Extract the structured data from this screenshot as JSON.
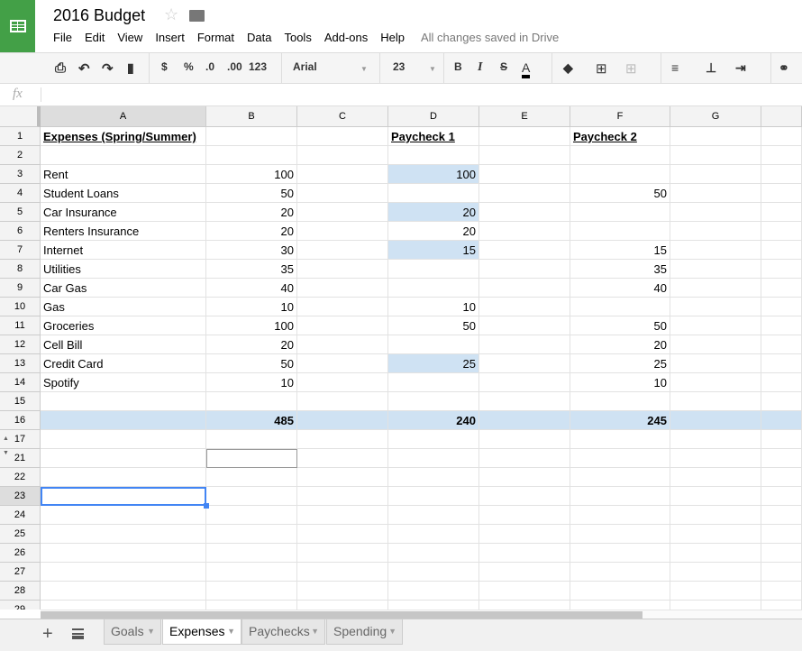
{
  "app": {
    "title": "2016 Budget",
    "status": "All changes saved in Drive",
    "accent": "#43a047"
  },
  "menu": [
    "File",
    "Edit",
    "View",
    "Insert",
    "Format",
    "Data",
    "Tools",
    "Add-ons",
    "Help"
  ],
  "toolbar": {
    "dollar": "$",
    "percent": "%",
    "dec_less": ".0",
    "dec_more": ".00",
    "format": "123",
    "font": "Arial",
    "size": "23",
    "bold": "B",
    "italic": "I",
    "strike": "S",
    "textcolor": "A"
  },
  "formula_bar": {
    "label": "fx",
    "value": ""
  },
  "columns": [
    "A",
    "B",
    "C",
    "D",
    "E",
    "F",
    "G",
    ""
  ],
  "rows": [
    {
      "n": "1",
      "cells": [
        "Expenses (Spring/Summer)",
        "",
        "",
        "Paycheck 1",
        "",
        "Paycheck 2",
        ""
      ]
    },
    {
      "n": "2",
      "cells": [
        "",
        "",
        "",
        "",
        "",
        "",
        ""
      ]
    },
    {
      "n": "3",
      "cells": [
        "Rent",
        "100",
        "",
        "100",
        "",
        "",
        ""
      ]
    },
    {
      "n": "4",
      "cells": [
        "Student Loans",
        "50",
        "",
        "",
        "",
        "50",
        ""
      ]
    },
    {
      "n": "5",
      "cells": [
        "Car Insurance",
        "20",
        "",
        "20",
        "",
        "",
        ""
      ]
    },
    {
      "n": "6",
      "cells": [
        "Renters Insurance",
        "20",
        "",
        "20",
        "",
        "",
        ""
      ]
    },
    {
      "n": "7",
      "cells": [
        "Internet",
        "30",
        "",
        "15",
        "",
        "15",
        ""
      ]
    },
    {
      "n": "8",
      "cells": [
        "Utilities",
        "35",
        "",
        "",
        "",
        "35",
        ""
      ]
    },
    {
      "n": "9",
      "cells": [
        "Car Gas",
        "40",
        "",
        "",
        "",
        "40",
        ""
      ]
    },
    {
      "n": "10",
      "cells": [
        "Gas",
        "10",
        "",
        "10",
        "",
        "",
        ""
      ]
    },
    {
      "n": "11",
      "cells": [
        "Groceries",
        "100",
        "",
        "50",
        "",
        "50",
        ""
      ]
    },
    {
      "n": "12",
      "cells": [
        "Cell Bill",
        "20",
        "",
        "",
        "",
        "20",
        ""
      ]
    },
    {
      "n": "13",
      "cells": [
        "Credit Card",
        "50",
        "",
        "25",
        "",
        "25",
        ""
      ]
    },
    {
      "n": "14",
      "cells": [
        "Spotify",
        "10",
        "",
        "",
        "",
        "10",
        ""
      ]
    },
    {
      "n": "15",
      "cells": [
        "",
        "",
        "",
        "",
        "",
        "",
        ""
      ]
    },
    {
      "n": "16",
      "cells": [
        "",
        "485",
        "",
        "240",
        "",
        "245",
        ""
      ]
    },
    {
      "n": "17",
      "cells": [
        "",
        "",
        "",
        "",
        "",
        "",
        ""
      ]
    },
    {
      "n": "21",
      "cells": [
        "",
        "",
        "",
        "",
        "",
        "",
        ""
      ]
    },
    {
      "n": "22",
      "cells": [
        "",
        "",
        "",
        "",
        "",
        "",
        ""
      ]
    },
    {
      "n": "23",
      "cells": [
        "",
        "",
        "",
        "",
        "",
        "",
        ""
      ]
    },
    {
      "n": "24",
      "cells": [
        "",
        "",
        "",
        "",
        "",
        "",
        ""
      ]
    },
    {
      "n": "25",
      "cells": [
        "",
        "",
        "",
        "",
        "",
        "",
        ""
      ]
    },
    {
      "n": "26",
      "cells": [
        "",
        "",
        "",
        "",
        "",
        "",
        ""
      ]
    },
    {
      "n": "27",
      "cells": [
        "",
        "",
        "",
        "",
        "",
        "",
        ""
      ]
    },
    {
      "n": "28",
      "cells": [
        "",
        "",
        "",
        "",
        "",
        "",
        ""
      ]
    },
    {
      "n": "29",
      "cells": [
        "",
        "",
        "",
        "",
        "",
        "",
        ""
      ]
    }
  ],
  "highlight_color": "#cfe2f3",
  "highlighted_cells": [
    "D3",
    "D5",
    "D7",
    "D13"
  ],
  "total_row": "16",
  "selected_cell": "A23",
  "sheets": [
    {
      "label": "Goals",
      "active": false
    },
    {
      "label": "Expenses",
      "active": true
    },
    {
      "label": "Paychecks",
      "active": false
    },
    {
      "label": "Spending",
      "active": false
    }
  ]
}
